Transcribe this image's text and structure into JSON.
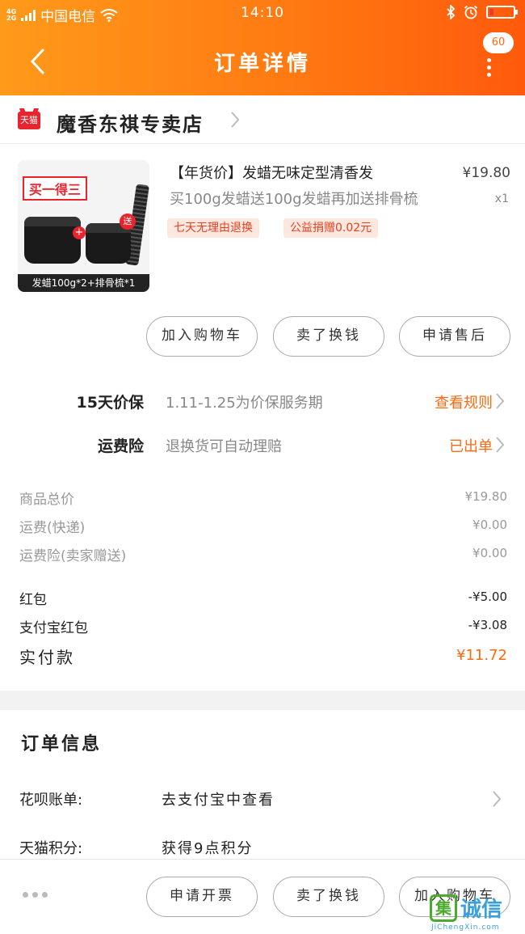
{
  "status_bar": {
    "network_type": "4G",
    "network_type_2": "2G",
    "carrier": "中国电信",
    "time": "14:10"
  },
  "header": {
    "title": "订单详情",
    "message_badge": "60"
  },
  "shop": {
    "platform_logo": "天猫",
    "name": "魔香东祺专卖店"
  },
  "product": {
    "image_promo": "买一得三",
    "image_gift": "送",
    "image_caption": "发蜡100g*2+排骨梳*1",
    "title_line1": "【年货价】发蜡无味定型清香发",
    "title_line2": "买100g发蜡送100g发蜡再加送排骨梳",
    "price": "¥19.80",
    "quantity": "x1",
    "tags": [
      "七天无理由退换",
      "公益捐赠0.02元"
    ]
  },
  "actions": {
    "add_to_cart": "加入购物车",
    "resell": "卖了换钱",
    "after_sale": "申请售后"
  },
  "services": [
    {
      "label": "15天价保",
      "desc": "1.11-1.25为价保服务期",
      "link": "查看规则"
    },
    {
      "label": "运费险",
      "desc": "退换货可自动理赔",
      "link": "已出单"
    }
  ],
  "price_breakdown": [
    {
      "label": "商品总价",
      "value": "¥19.80"
    },
    {
      "label": "运费(快递)",
      "value": "¥0.00"
    },
    {
      "label": "运费险(卖家赠送)",
      "value": "¥0.00"
    },
    {
      "label": "红包",
      "value": "-¥5.00"
    },
    {
      "label": "支付宝红包",
      "value": "-¥3.08"
    }
  ],
  "payment": {
    "label": "实付款",
    "value": "¥11.72"
  },
  "order_info": {
    "title": "订单信息",
    "rows": [
      {
        "label": "花呗账单:",
        "value": "去支付宝中查看"
      },
      {
        "label": "天猫积分:",
        "value": "获得9点积分"
      }
    ]
  },
  "bottom_bar": {
    "invoice": "申请开票",
    "resell": "卖了换钱",
    "add_to_cart": "加入购物车"
  },
  "watermark": {
    "mark": "集",
    "name": "诚信",
    "url": "JiChengXin.com"
  },
  "colors": {
    "header_start": "#ff9a1a",
    "header_end": "#ff5a0c",
    "accent": "#ff6a10",
    "tmall_red": "#e8242f"
  }
}
